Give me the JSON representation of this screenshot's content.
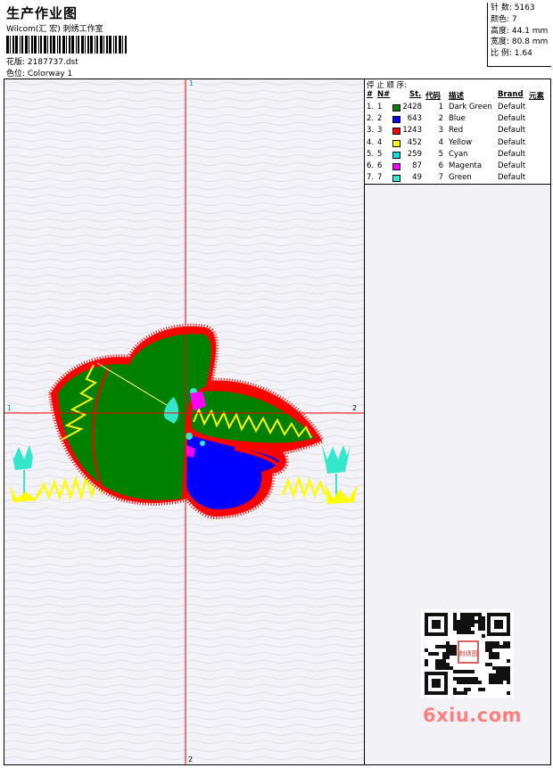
{
  "header": {
    "title": "生产作业图",
    "company": "Wilcom(汇 宏) 刺绣工作室",
    "file_label": "花版: 2187737.dst",
    "colorway_label": "色位: Colorway 1"
  },
  "stats": [
    "针 数: 5163",
    "颜色: 7",
    "高度: 44.1 mm",
    "宽度: 80.8 mm",
    "比 例: 1.64"
  ],
  "legend": {
    "caption": "停 止 顺 序:",
    "headers": {
      "num": "#",
      "n": "N#",
      "stitches": "St.",
      "code": "代码",
      "desc": "描述",
      "brand": "Brand",
      "element": "元素"
    },
    "rows": [
      {
        "num": "1.",
        "n": "1",
        "color": "#008000",
        "stitches": "2428",
        "code": "1",
        "desc": "Dark Green",
        "brand": "Default"
      },
      {
        "num": "2.",
        "n": "2",
        "color": "#0000ff",
        "stitches": "643",
        "code": "2",
        "desc": "Blue",
        "brand": "Default"
      },
      {
        "num": "3.",
        "n": "3",
        "color": "#ff0000",
        "stitches": "1243",
        "code": "3",
        "desc": "Red",
        "brand": "Default"
      },
      {
        "num": "4.",
        "n": "4",
        "color": "#ffff00",
        "stitches": "452",
        "code": "4",
        "desc": "Yellow",
        "brand": "Default"
      },
      {
        "num": "5.",
        "n": "5",
        "color": "#00e0e0",
        "stitches": "259",
        "code": "5",
        "desc": "Cyan",
        "brand": "Default"
      },
      {
        "num": "6.",
        "n": "6",
        "color": "#ff00ff",
        "stitches": "87",
        "code": "6",
        "desc": "Magenta",
        "brand": "Default"
      },
      {
        "num": "7.",
        "n": "7",
        "color": "#33e6cc",
        "stitches": "49",
        "code": "7",
        "desc": "Green",
        "brand": "Default"
      }
    ]
  },
  "axis": {
    "top": "1",
    "bottom": "2",
    "left": "1",
    "right": "2"
  },
  "watermark": {
    "text": "6xiu.com",
    "seal": "刺绣图"
  }
}
